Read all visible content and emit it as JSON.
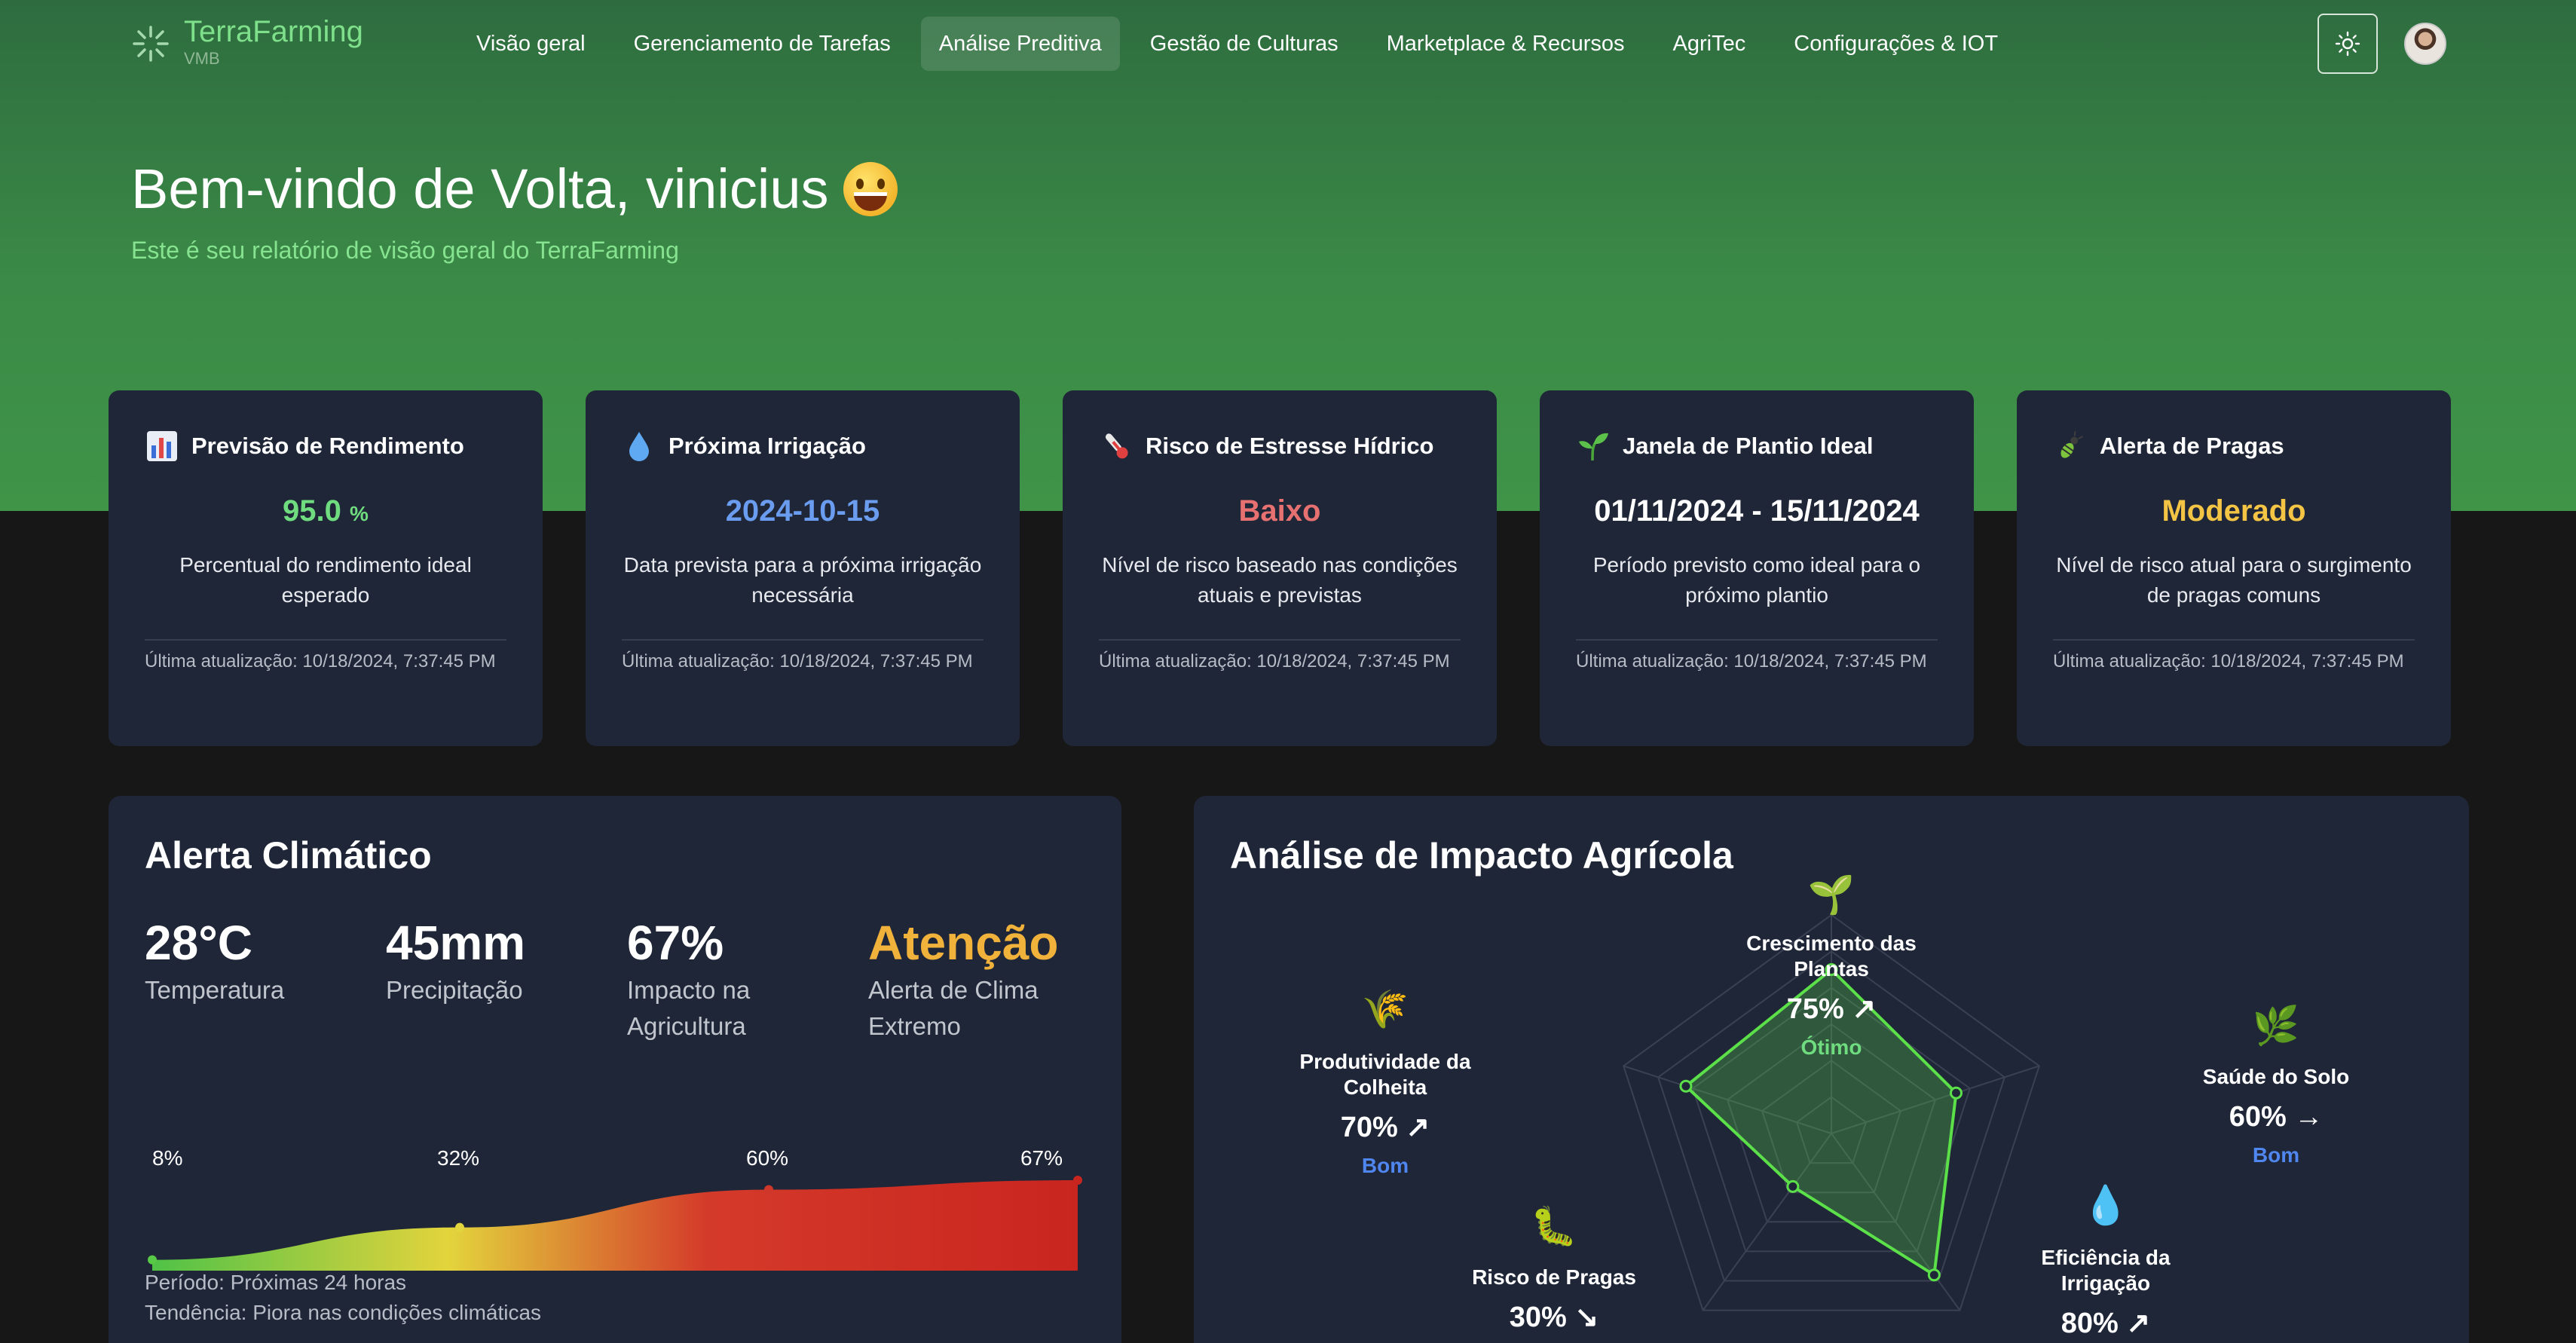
{
  "brand": {
    "name": "TerraFarming",
    "sub": "VMB"
  },
  "nav": [
    {
      "label": "Visão geral",
      "active": false
    },
    {
      "label": "Gerenciamento de Tarefas",
      "active": false
    },
    {
      "label": "Análise Preditiva",
      "active": true
    },
    {
      "label": "Gestão de Culturas",
      "active": false
    },
    {
      "label": "Marketplace & Recursos",
      "active": false
    },
    {
      "label": "AgriTec",
      "active": false
    },
    {
      "label": "Configurações & IOT",
      "active": false
    }
  ],
  "hero": {
    "title": "Bem-vindo de Volta, vinicius",
    "subtitle": "Este é seu relatório de visão geral do TerraFarming"
  },
  "cards": [
    {
      "icon": "bar-chart-icon",
      "title": "Previsão de Rendimento",
      "value": "95.0",
      "unit": "%",
      "color": "#6fdc7f",
      "desc": "Percentual do rendimento ideal esperado",
      "updated": "Última atualização: 10/18/2024, 7:37:45 PM"
    },
    {
      "icon": "droplet-icon",
      "title": "Próxima Irrigação",
      "value": "2024-10-15",
      "unit": "",
      "color": "#6a9cf0",
      "desc": "Data prevista para a próxima irrigação necessária",
      "updated": "Última atualização: 10/18/2024, 7:37:45 PM"
    },
    {
      "icon": "thermometer-icon",
      "title": "Risco de Estresse Hídrico",
      "value": "Baixo",
      "unit": "",
      "color": "#e77070",
      "desc": "Nível de risco baseado nas condições atuais e previstas",
      "updated": "Última atualização: 10/18/2024, 7:37:45 PM"
    },
    {
      "icon": "seedling-icon",
      "title": "Janela de Plantio Ideal",
      "value": "01/11/2024 - 15/11/2024",
      "unit": "",
      "color": "#ffffff",
      "desc": "Período previsto como ideal para o próximo plantio",
      "updated": "Última atualização: 10/18/2024, 7:37:45 PM"
    },
    {
      "icon": "bug-icon",
      "title": "Alerta de Pragas",
      "value": "Moderado",
      "unit": "",
      "color": "#f4c545",
      "desc": "Nível de risco atual para o surgimento de pragas comuns",
      "updated": "Última atualização: 10/18/2024, 7:37:45 PM"
    }
  ],
  "climate": {
    "title": "Alerta Climático",
    "metrics": [
      {
        "value": "28°C",
        "label": "Temperatura",
        "color": "#ffffff"
      },
      {
        "value": "45mm",
        "label": "Precipitação",
        "color": "#ffffff"
      },
      {
        "value": "67%",
        "label": "Impacto na Agricultura",
        "color": "#ffffff"
      },
      {
        "value": "Atenção",
        "label": "Alerta de Clima Extremo",
        "color": "#f1b23c"
      }
    ],
    "trend_labels": [
      "8%",
      "32%",
      "60%",
      "67%"
    ],
    "trend_values": [
      8,
      32,
      60,
      67
    ],
    "period": "Período: Próximas 24 horas",
    "trend": "Tendência: Piora nas condições climáticas"
  },
  "impact": {
    "title": "Análise de Impacto Agrícola",
    "axes": [
      {
        "icon": "seedling-icon",
        "name": "Crescimento das Plantas",
        "value": 75,
        "value_label": "75%",
        "trend": "up",
        "status": "Ótimo",
        "status_color": "#6fdc7f"
      },
      {
        "icon": "herb-icon",
        "name": "Saúde do Solo",
        "value": 60,
        "value_label": "60%",
        "trend": "flat",
        "status": "Bom",
        "status_color": "#4f86f0"
      },
      {
        "icon": "droplet-icon",
        "name": "Eficiência da Irrigação",
        "value": 80,
        "value_label": "80%",
        "trend": "up",
        "status": "",
        "status_color": "#4f86f0"
      },
      {
        "icon": "bug-icon",
        "name": "Risco de Pragas",
        "value": 30,
        "value_label": "30%",
        "trend": "down",
        "status": "",
        "status_color": "#4f86f0"
      },
      {
        "icon": "rice-icon",
        "name": "Produtividade da Colheita",
        "value": 70,
        "value_label": "70%",
        "trend": "up",
        "status": "Bom",
        "status_color": "#4f86f0"
      }
    ]
  }
}
